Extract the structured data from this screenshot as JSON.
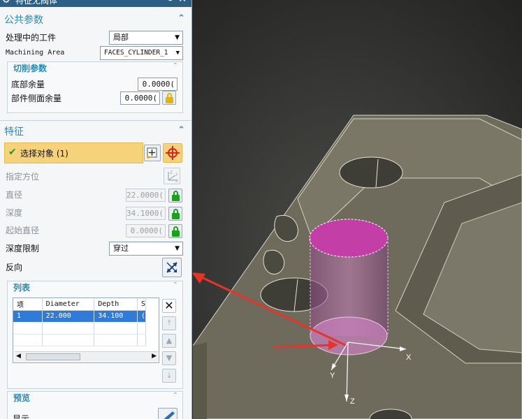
{
  "dialog": {
    "title": "特征无阀体",
    "common_params": {
      "header": "公共参数",
      "workpiece_label": "处理中的工件",
      "workpiece_value": "局部",
      "machining_area_label": "Machining Area",
      "machining_area_value": "FACES_CYLINDER_1",
      "cut_params": {
        "header": "切削参数",
        "floor_stock_label": "底部余量",
        "floor_stock_value": "0.0000(",
        "wall_stock_label": "部件侧面余量",
        "wall_stock_value": "0.0000("
      }
    },
    "feature": {
      "header": "特征",
      "select_object_label": "选择对象 (1)",
      "specify_orientation_label": "指定方位",
      "diameter_label": "直径",
      "diameter_value": "22.0000(",
      "depth_label": "深度",
      "depth_value": "34.1000(",
      "start_diameter_label": "起始直径",
      "start_diameter_value": "0.0000(",
      "depth_limit_label": "深度限制",
      "depth_limit_value": "穿过",
      "reverse_label": "反向"
    },
    "list": {
      "header": "列表",
      "columns": [
        "项",
        "Diameter",
        "Depth",
        "S"
      ],
      "rows": [
        {
          "item": "1",
          "diameter": "22.000",
          "depth": "34.100",
          "s": "("
        }
      ]
    },
    "preview": {
      "header": "预览",
      "show_label": "显示"
    }
  },
  "viewport": {
    "axis_x": "X",
    "axis_y": "Y",
    "axis_z": "Z"
  },
  "colors": {
    "accent": "#2a8ab0",
    "selection_highlight": "#f6d27a",
    "selected_row": "#2f7bd9",
    "selected_face": "#c43ea8",
    "annotation_arrow": "#e8332a",
    "model_body": "#6e6b5c"
  },
  "icons": {
    "title": "gear-icon",
    "window_controls": [
      "restore-icon",
      "close-icon"
    ],
    "select_check": "checkmark-icon",
    "add_object": "add-object-icon",
    "crosshair": "crosshair-icon",
    "orientation": "csys-icon",
    "lock": "lock-icon",
    "reverse": "reverse-direction-icon",
    "delete": "delete-icon",
    "move_top": "move-to-top-icon",
    "move_up": "move-up-icon",
    "move_down": "move-down-icon",
    "move_bottom": "move-to-bottom-icon",
    "show": "show-icon"
  }
}
